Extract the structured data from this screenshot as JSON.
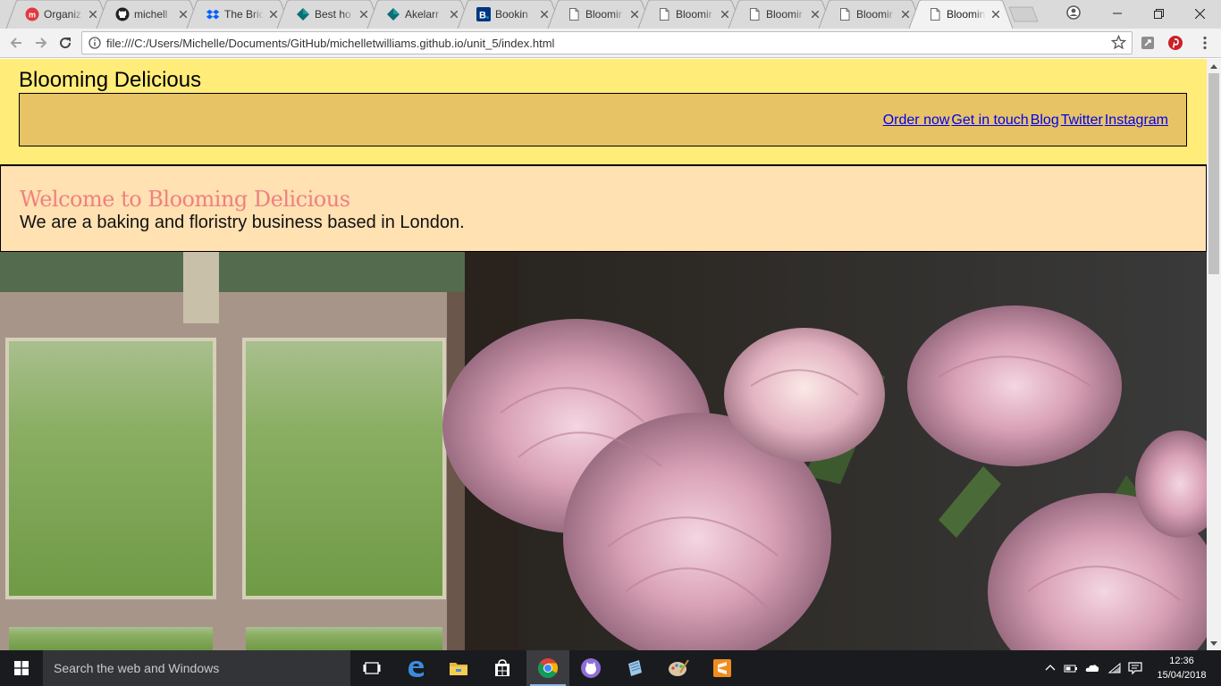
{
  "browser": {
    "tabs": [
      {
        "title": "Organiz",
        "icon": "meetup-icon"
      },
      {
        "title": "michell",
        "icon": "github-icon"
      },
      {
        "title": "The Bric",
        "icon": "dropbox-icon"
      },
      {
        "title": "Best ho",
        "icon": "diamond-icon"
      },
      {
        "title": "Akelarr",
        "icon": "diamond-icon"
      },
      {
        "title": "Bookin",
        "icon": "booking-icon"
      },
      {
        "title": "Bloomir",
        "icon": "page-icon"
      },
      {
        "title": "Bloomir",
        "icon": "page-icon"
      },
      {
        "title": "Bloomir",
        "icon": "page-icon"
      },
      {
        "title": "Bloomir",
        "icon": "page-icon"
      },
      {
        "title": "Bloomin",
        "icon": "page-icon",
        "active": true
      }
    ],
    "url": "file:///C:/Users/Michelle/Documents/GitHub/michelletwilliams.github.io/unit_5/index.html"
  },
  "page": {
    "site_title": "Blooming Delicious",
    "nav_links": [
      "Order now",
      "Get in touch",
      "Blog",
      "Twitter",
      "Instagram"
    ],
    "welcome_heading": "Welcome to Blooming Delicious",
    "welcome_text": "We are a baking and floristry business based in London.",
    "hero_alt": "Pink peonies in a vase by a window"
  },
  "colors": {
    "header_bg": "#ffec79",
    "nav_bg": "#e8c365",
    "welcome_bg": "#ffe1b2",
    "heading_color": "#f08080",
    "link_color": "#0000ee"
  },
  "taskbar": {
    "search_placeholder": "Search the web and Windows",
    "time": "12:36",
    "date": "15/04/2018"
  }
}
